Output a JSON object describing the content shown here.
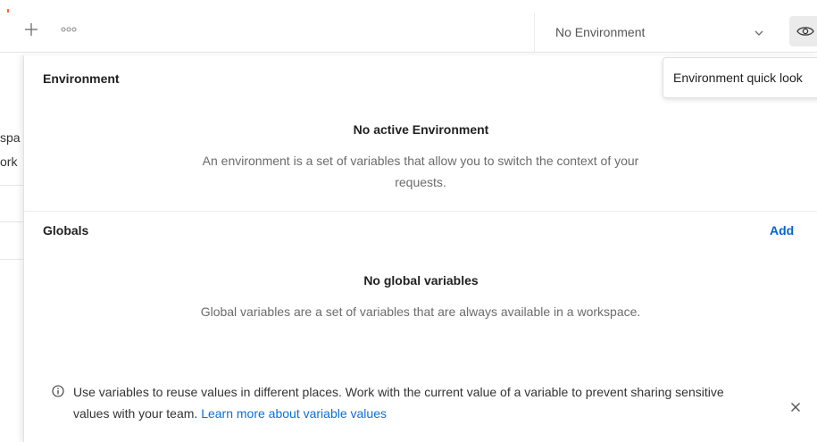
{
  "topbar": {
    "new_tab_icon": "plus-icon",
    "more_icon": "more-horizontal-icon",
    "environment_selector": {
      "label": "No Environment",
      "icon": "chevron-down-icon"
    },
    "quick_look_icon": "eye-icon"
  },
  "tooltip": {
    "text": "Environment quick look"
  },
  "sidebar_fragments": {
    "line1": "spa",
    "line2": "ork"
  },
  "environment_section": {
    "title": "Environment",
    "empty_title": "No active Environment",
    "empty_description": "An environment is a set of variables that allow you to switch the context of your requests."
  },
  "globals_section": {
    "title": "Globals",
    "add_label": "Add",
    "empty_title": "No global variables",
    "empty_description": "Global variables are a set of variables that are always available in a workspace."
  },
  "info_banner": {
    "icon": "info-icon",
    "text": "Use variables to reuse values in different places. Work with the current value of a variable to prevent sharing sensitive values with your team.",
    "link_text": "Learn more about variable values",
    "close_icon": "close-icon"
  },
  "colors": {
    "accent": "#ff6c37",
    "link": "#0265d2",
    "muted_text": "#6b6b6b"
  }
}
